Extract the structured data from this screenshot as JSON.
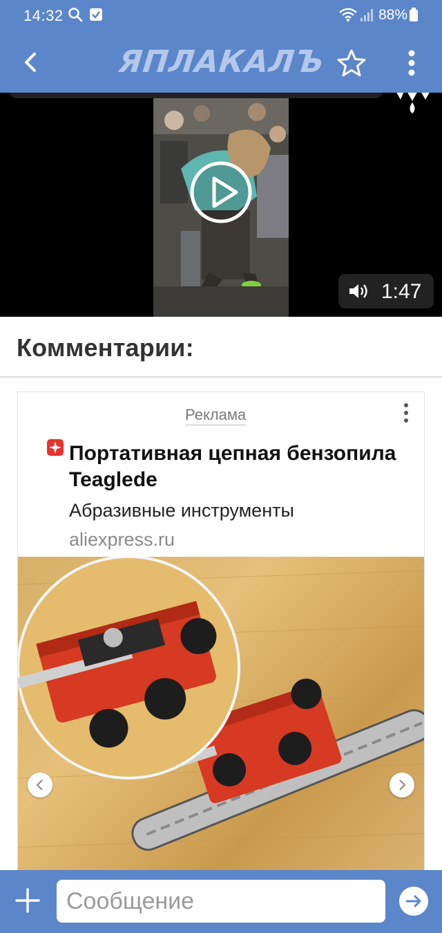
{
  "status_bar": {
    "time": "14:32",
    "battery_percent": "88%",
    "icons": [
      "search-icon",
      "checkbox-icon",
      "wifi-icon",
      "signal-icon",
      "battery-icon"
    ]
  },
  "app_bar": {
    "logo_text": "ЯПЛАКАЛЪ",
    "icons": [
      "back-arrow-icon",
      "star-icon",
      "more-vertical-icon"
    ]
  },
  "video": {
    "duration": "1:47",
    "icons": [
      "play-icon",
      "speaker-icon",
      "site-watermark-icon"
    ]
  },
  "comments": {
    "title": "Комментарии:"
  },
  "ad": {
    "label": "Реклама",
    "headline": "Портативная цепная бензопила Teaglede",
    "subline": "Абразивные инструменты",
    "domain": "aliexpress.ru",
    "icons": [
      "yandex-ad-icon",
      "more-vertical-icon",
      "chevron-left-icon",
      "chevron-right-icon"
    ]
  },
  "message_bar": {
    "placeholder": "Сообщение",
    "icons": [
      "plus-icon",
      "send-arrow-icon"
    ]
  },
  "colors": {
    "brand_blue": "#5b86c9",
    "logo_light": "#b3c8ec",
    "product_red": "#d63a22"
  }
}
